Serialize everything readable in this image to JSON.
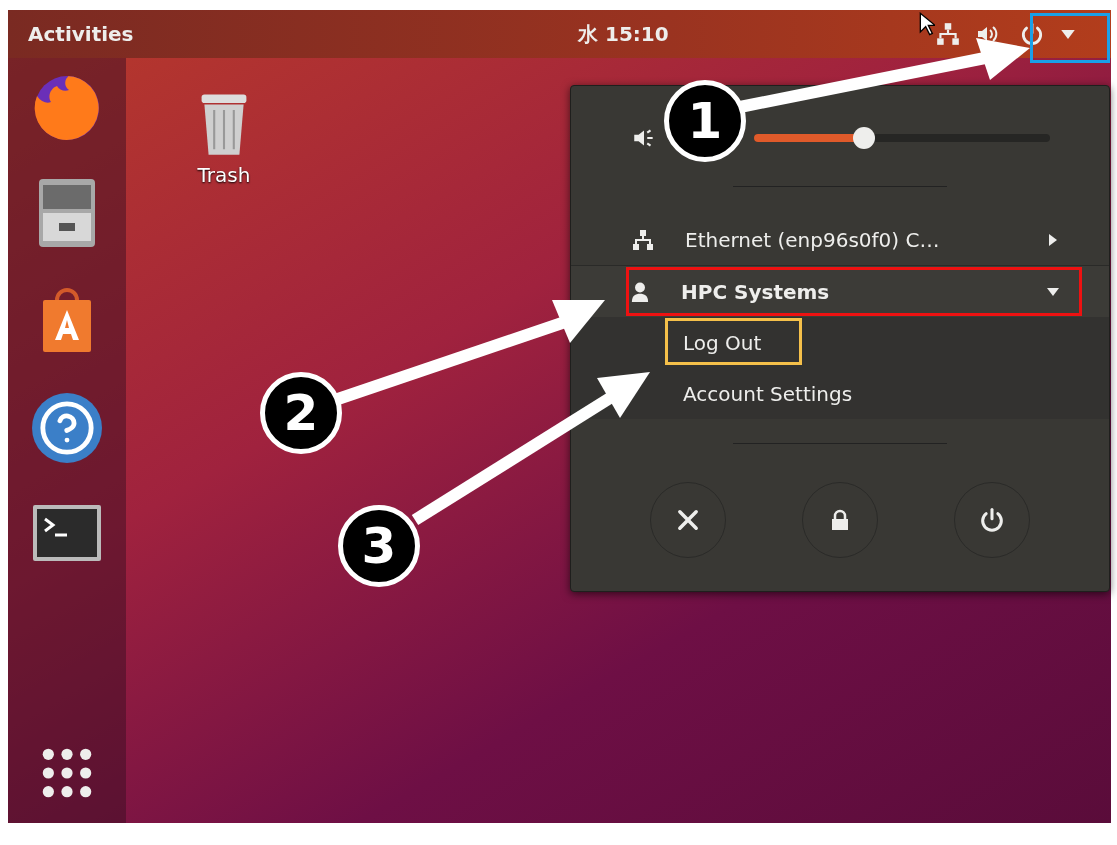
{
  "top_bar": {
    "activities": "Activities",
    "clock": "水 15:10"
  },
  "desktop_icons": [
    {
      "label": "Trash"
    }
  ],
  "menu": {
    "volume": {
      "level": 0.37
    },
    "items": [
      {
        "kind": "network",
        "label": "Ethernet (enp96s0f0) C…",
        "expanded": false
      },
      {
        "kind": "user",
        "label": "HPC Systems",
        "expanded": true,
        "children": [
          {
            "label": "Log Out"
          },
          {
            "label": "Account Settings"
          }
        ]
      }
    ]
  },
  "annotations": [
    {
      "number": "1"
    },
    {
      "number": "2"
    },
    {
      "number": "3"
    }
  ]
}
